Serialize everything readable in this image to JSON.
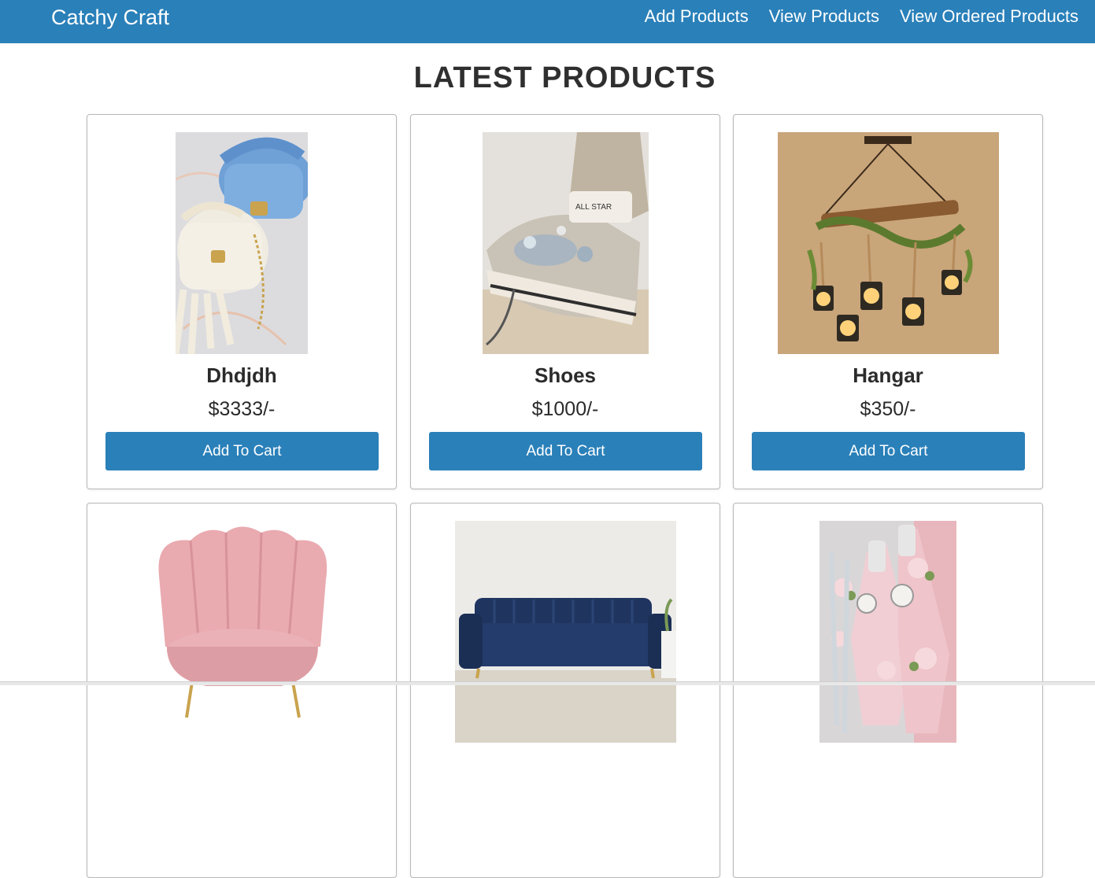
{
  "navbar": {
    "brand": "Catchy Craft",
    "links": [
      "Add Products",
      "View Products",
      "View Ordered Products"
    ],
    "background": "#2a80b9"
  },
  "heading": "LATEST PRODUCTS",
  "products": [
    {
      "name": "Dhdjdh",
      "price": "$3333/-",
      "button": "Add To Cart",
      "image": "crochet-bags-image"
    },
    {
      "name": "Shoes",
      "price": "$1000/-",
      "button": "Add To Cart",
      "image": "embellished-sneaker-image"
    },
    {
      "name": "Hangar",
      "price": "$350/-",
      "button": "Add To Cart",
      "image": "hanging-lamp-image"
    },
    {
      "name": "",
      "price": "",
      "button": "",
      "image": "pink-armchair-image"
    },
    {
      "name": "",
      "price": "",
      "button": "",
      "image": "blue-sofa-image"
    },
    {
      "name": "",
      "price": "",
      "button": "",
      "image": "decorated-bottles-image"
    }
  ]
}
